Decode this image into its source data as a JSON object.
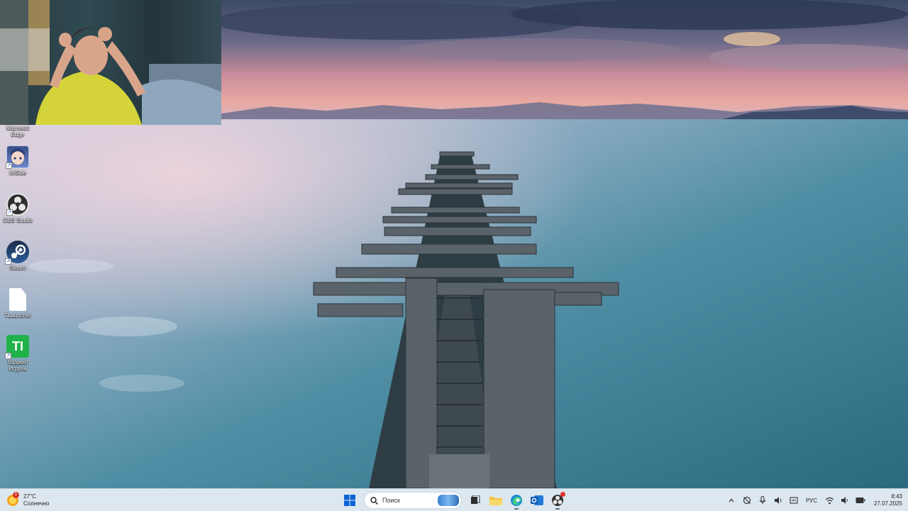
{
  "desktop": {
    "icons": [
      {
        "name": "edge",
        "label": "Microsoft Edge",
        "icon": "edge-icon"
      },
      {
        "name": "miside",
        "label": "MiSide",
        "icon": "miside-icon"
      },
      {
        "name": "obs",
        "label": "OBS Studio",
        "icon": "obs-icon"
      },
      {
        "name": "steam",
        "label": "Steam",
        "icon": "steam-icon"
      },
      {
        "name": "tlauncher",
        "label": "TLauncher",
        "icon": "file-icon"
      },
      {
        "name": "torrent",
        "label": "Торрент Игруха",
        "icon": "torrent-icon",
        "glyph": "TI"
      }
    ]
  },
  "taskbar": {
    "weather": {
      "temp": "27°C",
      "condition": "Солнечно",
      "badge": "1",
      "icon": "sun-icon"
    },
    "start_icon": "windows-logo-icon",
    "search_placeholder": "Поиск",
    "pinned": [
      "task-view-icon",
      "file-explorer-icon",
      "edge-icon",
      "outlook-icon",
      "obs-icon"
    ],
    "tray": {
      "icons": [
        "chevron-up-icon",
        "network-off-icon",
        "microphone-icon",
        "speaker-icon",
        "tray-app-icon"
      ],
      "language": "РУС",
      "status_icons": [
        "wifi-icon",
        "volume-icon",
        "battery-icon"
      ]
    },
    "clock": {
      "time": "8:43",
      "date": "27.07.2025"
    }
  },
  "colors": {
    "taskbar_bg": "#dde7f0",
    "accent": "#0a64d8",
    "notification": "#e3352a"
  }
}
